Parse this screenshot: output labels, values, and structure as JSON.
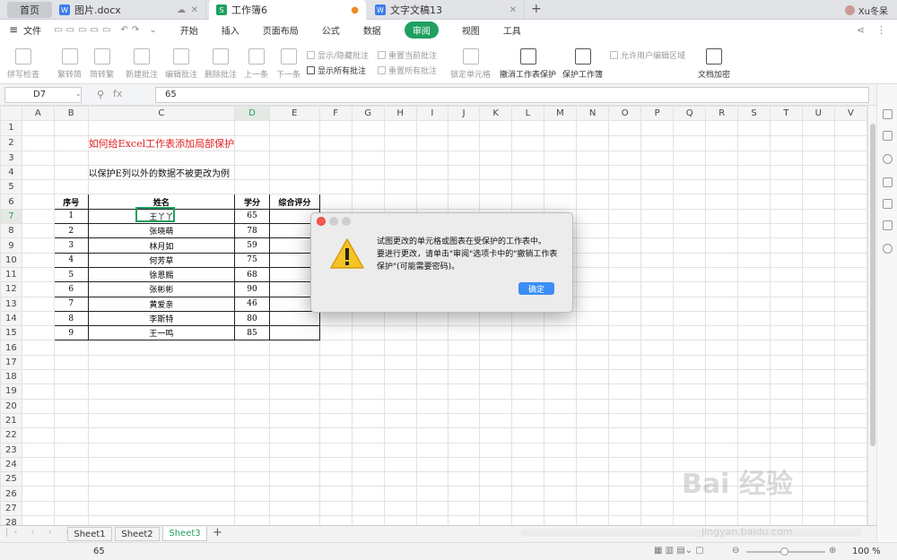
{
  "tabs": {
    "home": "首页",
    "t1": "图片.docx",
    "t2": "工作簿6",
    "t3": "文字文稿13",
    "user": "Xu冬呆"
  },
  "menu": {
    "file": "文件",
    "items": [
      "开始",
      "插入",
      "页面布局",
      "公式",
      "数据",
      "审阅",
      "视图",
      "工具"
    ],
    "active": "审阅"
  },
  "toolbar": {
    "spell": "拼写检查",
    "trad2simp": "繁转简",
    "simp2trad": "简转繁",
    "newcomment": "新建批注",
    "editcomment": "编辑批注",
    "delcomment": "删除批注",
    "prev": "上一条",
    "next": "下一条",
    "showhide": "显示/隐藏批注",
    "showall": "显示所有批注",
    "resetcur": "重置当前批注",
    "resetall": "重置所有批注",
    "lockcell": "锁定单元格",
    "unprotect": "撤消工作表保护",
    "protectbook": "保护工作簿",
    "allowedit": "允许用户编辑区域",
    "encrypt": "文档加密"
  },
  "formula": {
    "namebox": "D7",
    "fx": "fx",
    "value": "65"
  },
  "columns": [
    "A",
    "B",
    "C",
    "D",
    "E",
    "F",
    "G",
    "H",
    "I",
    "J",
    "K",
    "L",
    "M",
    "N",
    "O",
    "P",
    "Q",
    "R",
    "S",
    "T",
    "U",
    "V"
  ],
  "sheet": {
    "title": "如何给Excel工作表添加局部保护",
    "note": "以保护E列以外的数据不被更改为例",
    "headers": [
      "序号",
      "姓名",
      "学分",
      "综合评分"
    ],
    "rows": [
      [
        "1",
        "王丫丫",
        "65"
      ],
      [
        "2",
        "张晓萌",
        "78"
      ],
      [
        "3",
        "林月如",
        "59"
      ],
      [
        "4",
        "何芳草",
        "75"
      ],
      [
        "5",
        "徐恩赐",
        "68"
      ],
      [
        "6",
        "张彬彬",
        "90"
      ],
      [
        "7",
        "黄爱亲",
        "46"
      ],
      [
        "8",
        "李斯特",
        "80"
      ],
      [
        "9",
        "王一鸣",
        "85"
      ]
    ]
  },
  "sheets": [
    "Sheet1",
    "Sheet2",
    "Sheet3"
  ],
  "active_sheet": "Sheet3",
  "status": {
    "value": "65",
    "zoom": "100 %"
  },
  "dialog": {
    "line1": "试图更改的单元格或图表在受保护的工作表中。",
    "line2": "要进行更改，请单击\"审阅\"选项卡中的\"撤销工作表保护\"(可能需要密码)。",
    "ok": "确定"
  },
  "watermark": {
    "brand": "Bai 经验",
    "url": "jingyan.baidu.com"
  },
  "colors": {
    "accent": "#1fa060",
    "title_red": "#e12020",
    "ok_blue": "#3a8ef6"
  }
}
